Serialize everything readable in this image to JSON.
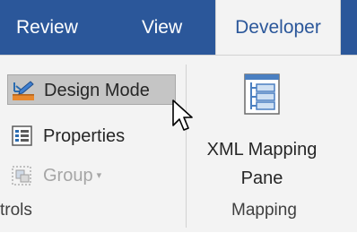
{
  "tabs": {
    "review": "Review",
    "view": "View",
    "developer": "Developer"
  },
  "controls_group": {
    "design_mode": "Design Mode",
    "properties": "Properties",
    "group": "Group",
    "group_caret": "▾",
    "label": "trols"
  },
  "mapping_group": {
    "xml_line1": "XML Mapping",
    "xml_line2": "Pane",
    "label": "Mapping"
  },
  "colors": {
    "tab_bar": "#2b579a",
    "ribbon_bg": "#f3f3f3",
    "pressed_button": "#c5c5c5",
    "accent_orange": "#e8882e"
  },
  "icons": [
    "design-mode-icon",
    "properties-icon",
    "group-icon",
    "xml-mapping-pane-icon",
    "mouse-pointer-icon"
  ]
}
